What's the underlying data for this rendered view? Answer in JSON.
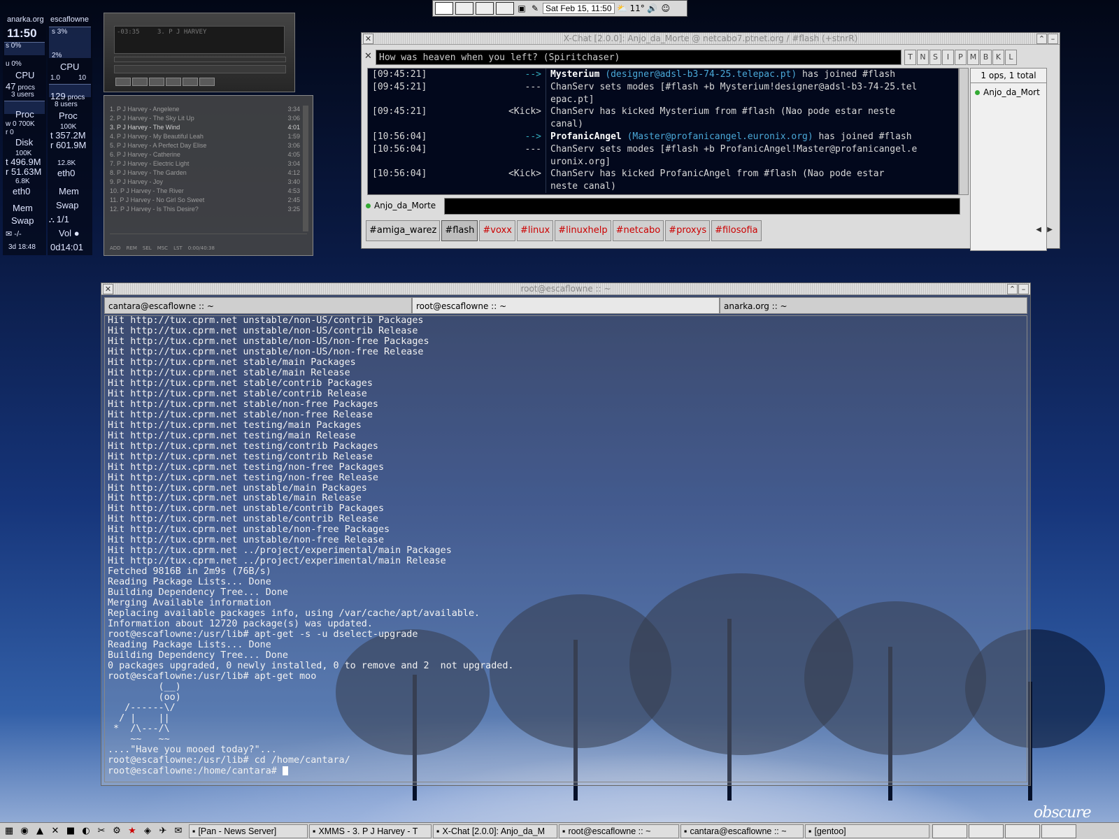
{
  "top_panel": {
    "clock": "Sat Feb 15, 11:50",
    "temperature": "11°"
  },
  "gkrellm_left": {
    "host": "anarka.org",
    "time": "11:50",
    "cpu_s": "0%",
    "cpu_u": "0%",
    "cpu_label": "CPU",
    "procs": "47",
    "procs_unit": "procs",
    "users": "3 users",
    "proc_label": "Proc",
    "disk_w": "0",
    "disk_w_scale": "700K",
    "disk_r": "0",
    "disk_label": "Disk",
    "disk_scale": "100K",
    "eth_t": "496.9M",
    "eth_r": "51.63M",
    "eth_scale": "6.8K",
    "eth_label": "eth0",
    "mem_label": "Mem",
    "swap_label": "Swap",
    "mail": "-/-",
    "uptime": "3d 18:48"
  },
  "gkrellm_right": {
    "host": "escaflowne",
    "cpu_s": "3%",
    "cpu_u": "2%",
    "cpu_label": "CPU",
    "scale_min": "1.0",
    "scale_max": "10",
    "procs": "129",
    "procs_unit": "procs",
    "users": "8 users",
    "proc_label": "Proc",
    "proc_scale": "100K",
    "eth_t": "357.2M",
    "eth_r": "601.9M",
    "eth_scale": "12.8K",
    "eth_label": "eth0",
    "mem_label": "Mem",
    "swap_label": "Swap",
    "users_count": "1/1",
    "vol_label": "Vol",
    "uptime": "0d14:01"
  },
  "xmms": {
    "display_text": "3. P J HARVEY",
    "time": "-03:35",
    "playlist": [
      {
        "title": "1. P J Harvey - Angelene",
        "length": "3:34"
      },
      {
        "title": "2. P J Harvey - The Sky Lit Up",
        "length": "3:06"
      },
      {
        "title": "3. P J Harvey - The Wind",
        "length": "4:01"
      },
      {
        "title": "4. P J Harvey - My Beautiful Leah",
        "length": "1:59"
      },
      {
        "title": "5. P J Harvey - A Perfect Day Elise",
        "length": "3:06"
      },
      {
        "title": "6. P J Harvey - Catherine",
        "length": "4:05"
      },
      {
        "title": "7. P J Harvey - Electric Light",
        "length": "3:04"
      },
      {
        "title": "8. P J Harvey - The Garden",
        "length": "4:12"
      },
      {
        "title": "9. P J Harvey - Joy",
        "length": "3:40"
      },
      {
        "title": "10. P J Harvey - The River",
        "length": "4:53"
      },
      {
        "title": "11. P J Harvey - No Girl So Sweet",
        "length": "2:45"
      },
      {
        "title": "12. P J Harvey - Is This Desire?",
        "length": "3:25"
      }
    ],
    "playlist_buttons": [
      "ADD",
      "REM",
      "SEL",
      "MSC",
      "LST"
    ],
    "playlist_time": "0:00/40:38"
  },
  "xchat": {
    "title": "X-Chat [2.0.0]: Anjo_da_Morte @ netcabo7.ptnet.org / #flash (+stnrR)",
    "topic": "How was heaven when you left? (Spiritchaser)",
    "mode_buttons": [
      "T",
      "N",
      "S",
      "I",
      "P",
      "M",
      "B",
      "K",
      "L"
    ],
    "log": [
      {
        "ts": "[09:45:21]",
        "nick": "-->",
        "msg_bold": "Mysterium",
        "msg_host": "(designer@adsl-b3-74-25.telepac.pt)",
        "msg": "has joined #flash"
      },
      {
        "ts": "[09:45:21]",
        "nick": "---",
        "msg_bold": "",
        "msg_host": "",
        "msg": "ChanServ sets modes [#flash +b Mysterium!designer@adsl-b3-74-25.tel"
      },
      {
        "ts": "",
        "nick": "",
        "msg_bold": "",
        "msg_host": "",
        "msg": "epac.pt]"
      },
      {
        "ts": "[09:45:21]",
        "nick": "<Kick>",
        "msg_bold": "",
        "msg_host": "",
        "msg": "ChanServ has kicked Mysterium from #flash (Nao pode estar neste"
      },
      {
        "ts": "",
        "nick": "",
        "msg_bold": "",
        "msg_host": "",
        "msg": "canal)"
      },
      {
        "ts": "[10:56:04]",
        "nick": "-->",
        "msg_bold": "ProfanicAngel",
        "msg_host": "(Master@profanicangel.euronix.org)",
        "msg": "has joined #flash"
      },
      {
        "ts": "[10:56:04]",
        "nick": "---",
        "msg_bold": "",
        "msg_host": "",
        "msg": "ChanServ sets modes [#flash +b ProfanicAngel!Master@profanicangel.e"
      },
      {
        "ts": "",
        "nick": "",
        "msg_bold": "",
        "msg_host": "",
        "msg": "uronix.org]"
      },
      {
        "ts": "[10:56:04]",
        "nick": "<Kick>",
        "msg_bold": "",
        "msg_host": "",
        "msg": "ChanServ has kicked ProfanicAngel from #flash (Nao pode estar"
      },
      {
        "ts": "",
        "nick": "",
        "msg_bold": "",
        "msg_host": "",
        "msg": "neste canal)"
      }
    ],
    "userlist_header": "1 ops, 1 total",
    "users": [
      "Anjo_da_Mort"
    ],
    "my_nick": "Anjo_da_Morte",
    "tabs": [
      {
        "label": "#amiga_warez",
        "state": "plain"
      },
      {
        "label": "#flash",
        "state": "active"
      },
      {
        "label": "#voxx",
        "state": "alert"
      },
      {
        "label": "#linux",
        "state": "alert"
      },
      {
        "label": "#linuxhelp",
        "state": "alert"
      },
      {
        "label": "#netcabo",
        "state": "alert"
      },
      {
        "label": "#proxys",
        "state": "alert"
      },
      {
        "label": "#filosofia",
        "state": "alert"
      }
    ],
    "colors": {
      "host": "#4aa8d8",
      "alert_tab": "#cc0000",
      "join_arrow": "#3ab"
    }
  },
  "terminal": {
    "title": "root@escaflowne :: ~",
    "tabs": [
      {
        "label": "cantara@escaflowne :: ~",
        "active": false
      },
      {
        "label": "root@escaflowne :: ~",
        "active": true
      },
      {
        "label": "anarka.org :: ~",
        "active": false
      }
    ],
    "lines": [
      "Hit http://tux.cprm.net unstable/non-US/contrib Packages",
      "Hit http://tux.cprm.net unstable/non-US/contrib Release",
      "Hit http://tux.cprm.net unstable/non-US/non-free Packages",
      "Hit http://tux.cprm.net unstable/non-US/non-free Release",
      "Hit http://tux.cprm.net stable/main Packages",
      "Hit http://tux.cprm.net stable/main Release",
      "Hit http://tux.cprm.net stable/contrib Packages",
      "Hit http://tux.cprm.net stable/contrib Release",
      "Hit http://tux.cprm.net stable/non-free Packages",
      "Hit http://tux.cprm.net stable/non-free Release",
      "Hit http://tux.cprm.net testing/main Packages",
      "Hit http://tux.cprm.net testing/main Release",
      "Hit http://tux.cprm.net testing/contrib Packages",
      "Hit http://tux.cprm.net testing/contrib Release",
      "Hit http://tux.cprm.net testing/non-free Packages",
      "Hit http://tux.cprm.net testing/non-free Release",
      "Hit http://tux.cprm.net unstable/main Packages",
      "Hit http://tux.cprm.net unstable/main Release",
      "Hit http://tux.cprm.net unstable/contrib Packages",
      "Hit http://tux.cprm.net unstable/contrib Release",
      "Hit http://tux.cprm.net unstable/non-free Packages",
      "Hit http://tux.cprm.net unstable/non-free Release",
      "Hit http://tux.cprm.net ../project/experimental/main Packages",
      "Hit http://tux.cprm.net ../project/experimental/main Release",
      "Fetched 9816B in 2m9s (76B/s)",
      "Reading Package Lists... Done",
      "Building Dependency Tree... Done",
      "Merging Available information",
      "Replacing available packages info, using /var/cache/apt/available.",
      "Information about 12720 package(s) was updated.",
      "root@escaflowne:/usr/lib# apt-get -s -u dselect-upgrade",
      "Reading Package Lists... Done",
      "Building Dependency Tree... Done",
      "0 packages upgraded, 0 newly installed, 0 to remove and 2  not upgraded.",
      "root@escaflowne:/usr/lib# apt-get moo",
      "         (__)",
      "         (oo)",
      "   /------\\/",
      "  / |    ||",
      " *  /\\---/\\",
      "    ~~   ~~",
      "....\"Have you mooed today?\"...",
      "root@escaflowne:/usr/lib# cd /home/cantara/",
      "root@escaflowne:/home/cantara# "
    ]
  },
  "taskbar": {
    "tasks": [
      {
        "label": "[Pan - News Server]",
        "icon": "pan-icon"
      },
      {
        "label": "XMMS - 3. P J Harvey - T",
        "icon": "xmms-icon"
      },
      {
        "label": "X-Chat [2.0.0]: Anjo_da_M",
        "icon": "xchat-icon"
      },
      {
        "label": "root@escaflowne :: ~",
        "icon": "terminal-icon"
      },
      {
        "label": "cantara@escaflowne :: ~",
        "icon": "terminal-icon"
      },
      {
        "label": "[gentoo]",
        "icon": "gentoo-icon"
      }
    ]
  },
  "wallpaper_signature": "obscure"
}
